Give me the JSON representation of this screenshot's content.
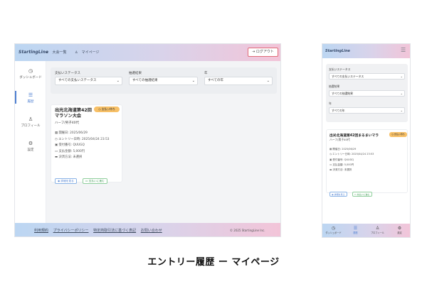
{
  "brand": "StartingLine",
  "desktop": {
    "nav": [
      "大会一覧",
      "マイページ"
    ],
    "logout_label": "ログアウト",
    "sidebar": [
      {
        "icon": "◷",
        "label": "ダッシュボード"
      },
      {
        "icon": "☰",
        "label": "履歴"
      },
      {
        "icon": "♙",
        "label": "プロフィール"
      },
      {
        "icon": "⚙",
        "label": "設定"
      }
    ],
    "filters": [
      {
        "label": "支払いステータス",
        "value": "すべての支払いステータス"
      },
      {
        "label": "抽選結果",
        "value": "すべての抽選結果"
      },
      {
        "label": "年",
        "value": "すべての年"
      }
    ],
    "card": {
      "badge": "支払い待ち",
      "title": "出光北海道第42回 マラソン大会",
      "subtitle": "ハーフ/男子40代",
      "rows": [
        "開催日: 2025/06/29",
        "エントリー日時: 2025/04/24 23:53",
        "受付番号: QUUGQ",
        "支払金額: 5,000円",
        "決済方法: 未選択"
      ],
      "buttons": [
        "詳細を見る",
        "支払いに進む"
      ]
    },
    "footer_links": [
      "利用規約",
      "プライバシーポリシー",
      "特定商取引法に基づく表記",
      "お問い合わせ"
    ],
    "copyright": "© 2025 StartingLine Inc."
  },
  "mobile": {
    "filters": [
      {
        "label": "支払いステータス",
        "value": "すべての支払いステータス"
      },
      {
        "label": "抽選結果",
        "value": "すべての抽選結果"
      },
      {
        "label": "年",
        "value": "すべての年"
      }
    ],
    "card": {
      "badge": "支払い待ち",
      "title": "出光北海道第42回まるまいマラ",
      "subtitle": "ハーフ/男子40代",
      "rows": [
        "開催日: 2025/06/29",
        "エントリー日時: 2025/04/24 23:53",
        "受付番号: QUUGQ",
        "支払金額: 5,000円",
        "決済方法: 未選択"
      ],
      "buttons": [
        "詳細を見る",
        "支払いに進む"
      ]
    },
    "bottom_nav": [
      {
        "icon": "◷",
        "label": "ダッシュボード"
      },
      {
        "icon": "☰",
        "label": "履歴"
      },
      {
        "icon": "♙",
        "label": "プロフィール"
      },
      {
        "icon": "⚙",
        "label": "設定"
      }
    ]
  },
  "caption": "エントリー履歴 ー マイページ",
  "colors": {
    "accent": "#4e7fd1",
    "badge": "#f7c067",
    "logout_border": "#e06a78"
  }
}
